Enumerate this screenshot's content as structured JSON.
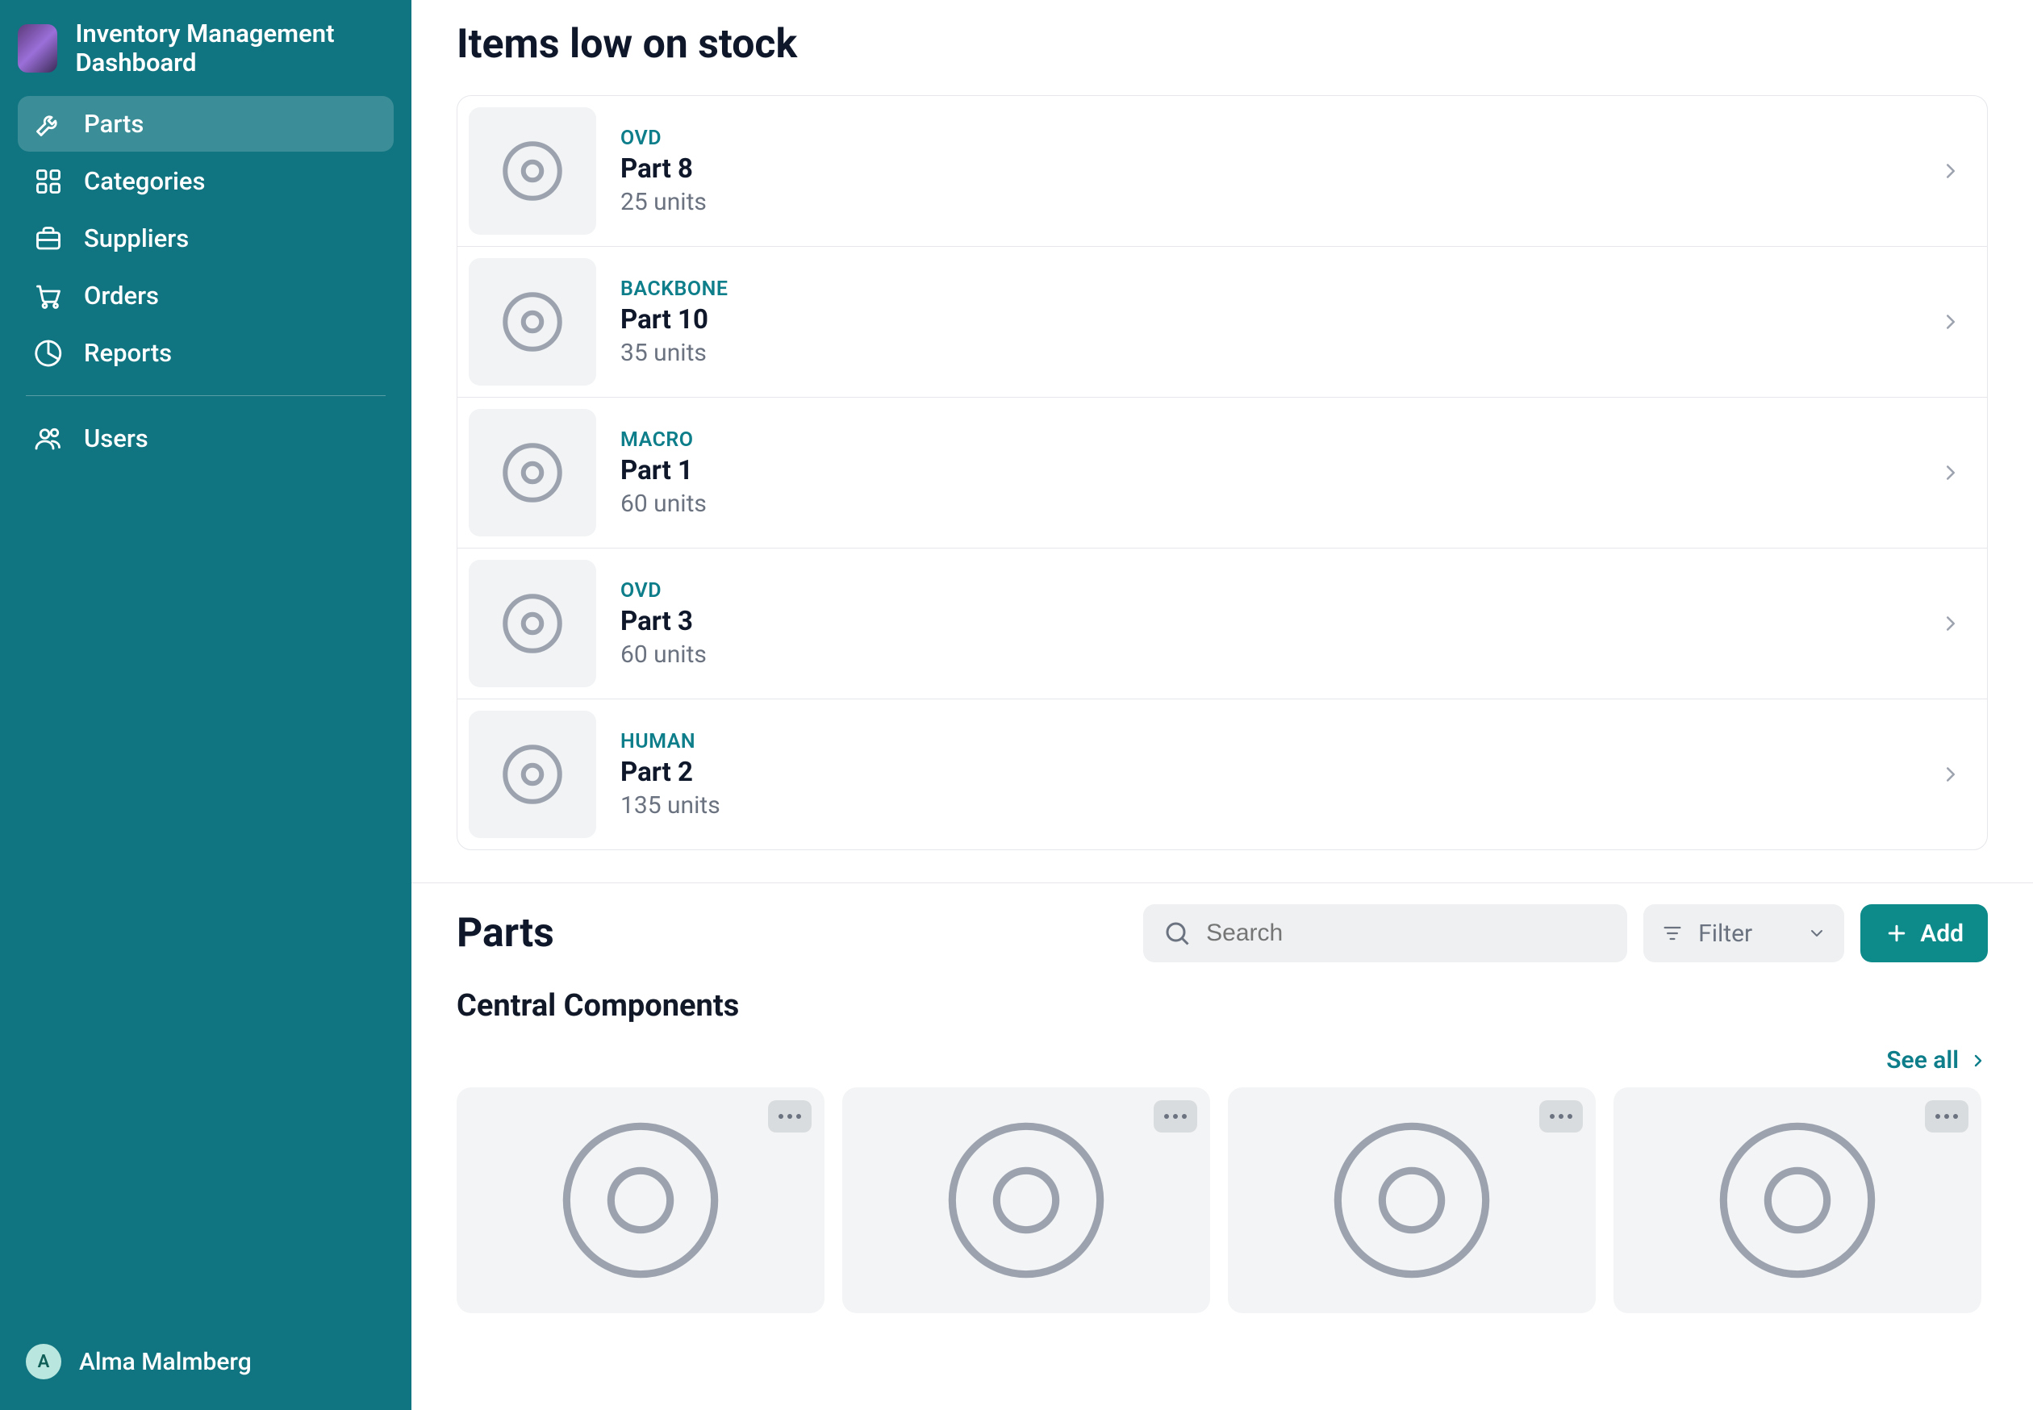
{
  "brand": {
    "title": "Inventory Management Dashboard"
  },
  "nav": [
    {
      "label": "Parts",
      "icon": "wrench",
      "active": true
    },
    {
      "label": "Categories",
      "icon": "grid",
      "active": false
    },
    {
      "label": "Suppliers",
      "icon": "briefcase",
      "active": false
    },
    {
      "label": "Orders",
      "icon": "cart",
      "active": false
    },
    {
      "label": "Reports",
      "icon": "pie",
      "active": false
    }
  ],
  "nav_secondary": [
    {
      "label": "Users",
      "icon": "users"
    }
  ],
  "user": {
    "name": "Alma Malmberg",
    "initial": "A"
  },
  "low_stock": {
    "title": "Items low on stock",
    "items": [
      {
        "category": "OVD",
        "name": "Part 8",
        "units": "25 units"
      },
      {
        "category": "BACKBONE",
        "name": "Part 10",
        "units": "35 units"
      },
      {
        "category": "MACRO",
        "name": "Part 1",
        "units": "60 units"
      },
      {
        "category": "OVD",
        "name": "Part 3",
        "units": "60 units"
      },
      {
        "category": "HUMAN",
        "name": "Part 2",
        "units": "135 units"
      }
    ]
  },
  "parts": {
    "title": "Parts",
    "search_placeholder": "Search",
    "filter_label": "Filter",
    "add_label": "Add",
    "group_title": "Central Components",
    "see_all_label": "See all",
    "cards_count": 4
  }
}
